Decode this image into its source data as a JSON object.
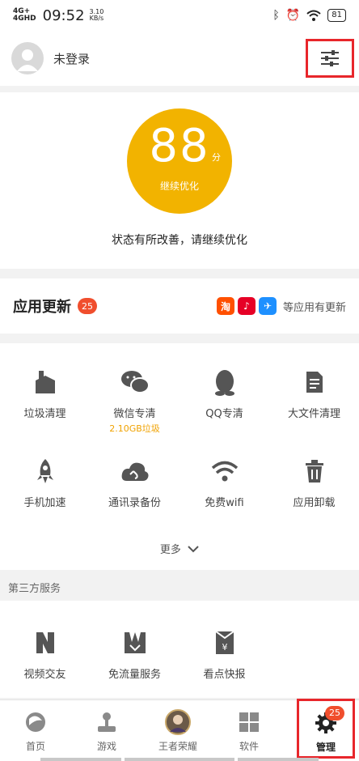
{
  "status_bar": {
    "signal1": "4G+",
    "signal2": "4GHD",
    "time": "09:52",
    "speed_value": "3.10",
    "speed_unit": "KB/s",
    "battery": "81"
  },
  "header": {
    "login_text": "未登录",
    "settings_icon": "sliders-icon"
  },
  "score": {
    "value": "88",
    "unit": "分",
    "subtitle": "继续优化",
    "status": "状态有所改善，请继续优化",
    "color": "#f2b300"
  },
  "updates": {
    "title": "应用更新",
    "count": "25",
    "apps": [
      {
        "icon": "taobao-icon",
        "glyph": "淘",
        "color": "#ff5000"
      },
      {
        "icon": "netease-music-icon",
        "glyph": "♪",
        "color": "#e60026"
      },
      {
        "icon": "dingtalk-icon",
        "glyph": "✈",
        "color": "#1e90ff"
      }
    ],
    "more_text": "等应用有更新"
  },
  "tools": [
    {
      "label": "垃圾清理",
      "sub": "",
      "icon": "broom-icon"
    },
    {
      "label": "微信专清",
      "sub": "2.10GB垃圾",
      "icon": "wechat-icon"
    },
    {
      "label": "QQ专清",
      "sub": "",
      "icon": "qq-penguin-icon"
    },
    {
      "label": "大文件清理",
      "sub": "",
      "icon": "file-icon"
    },
    {
      "label": "手机加速",
      "sub": "",
      "icon": "rocket-icon"
    },
    {
      "label": "通讯录备份",
      "sub": "",
      "icon": "cloud-sync-icon"
    },
    {
      "label": "免费wifi",
      "sub": "",
      "icon": "wifi-icon"
    },
    {
      "label": "应用卸载",
      "sub": "",
      "icon": "trash-icon"
    }
  ],
  "more_label": "更多",
  "third_party": {
    "heading": "第三方服务",
    "items": [
      {
        "label": "视频交友",
        "icon": "video-chat-icon"
      },
      {
        "label": "免流量服务",
        "icon": "data-free-icon"
      },
      {
        "label": "看点快报",
        "icon": "news-icon"
      }
    ]
  },
  "nav": [
    {
      "label": "首页",
      "icon": "home-swirl-icon"
    },
    {
      "label": "游戏",
      "icon": "joystick-icon"
    },
    {
      "label": "王者荣耀",
      "icon": "game-avatar-icon"
    },
    {
      "label": "软件",
      "icon": "apps-grid-icon"
    },
    {
      "label": "管理",
      "icon": "gear-icon",
      "badge": "25",
      "active": true
    }
  ],
  "colors": {
    "accent": "#f2b300",
    "badge": "#f04e2d",
    "highlight": "#e8262b"
  }
}
